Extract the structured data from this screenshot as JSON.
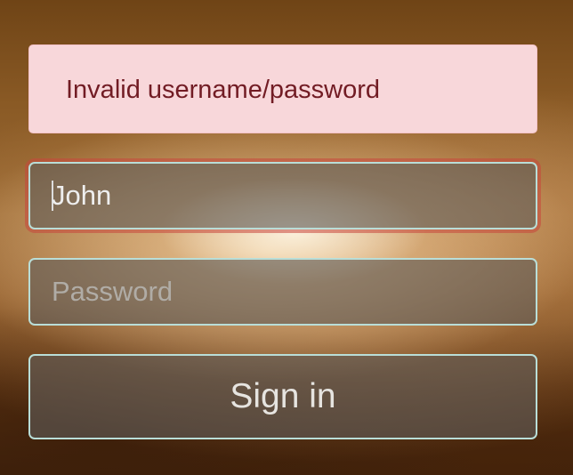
{
  "alert": {
    "message": "Invalid username/password",
    "bg_color": "#f8d7da",
    "text_color": "#721c24"
  },
  "username": {
    "value": "John",
    "state": "invalid"
  },
  "password": {
    "value": "",
    "placeholder": "Password"
  },
  "signin": {
    "label": "Sign in"
  },
  "accent_color": "#b9ded8"
}
